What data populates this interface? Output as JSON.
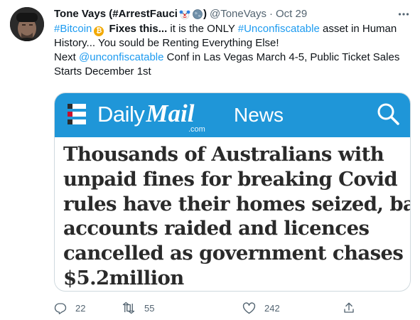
{
  "tweet": {
    "display_name": "Tone Vays (#ArrestFauci",
    "display_name_close": ")",
    "handle": "@ToneVays",
    "separator": "·",
    "date": "Oct 29",
    "more_label": "···",
    "text": {
      "hashtag_bitcoin": "#Bitcoin",
      "bitcoin_symbol": "₿",
      "fixes_this": "Fixes this...",
      "line1_mid": " it is the ONLY ",
      "hashtag_unconfiscatable": "#Unconfiscatable",
      "line1_end": " asset in Human",
      "line2": "History... You sould be Renting Everything Else!",
      "line3_start": "Next ",
      "mention": "@unconfiscatable",
      "line3_end": " Conf in Las Vegas March 4-5, Public Ticket Sales",
      "line4": "Starts December 1st"
    },
    "emoji_icons": [
      "clown-face-icon",
      "globe-icon"
    ]
  },
  "media": {
    "brand_daily": "Daily",
    "brand_mail": "Mail",
    "brand_com": ".com",
    "section": "News",
    "header_color": "#1f96d8",
    "headline_lines": [
      "Thousands of Australians with",
      "unpaid fines for breaking Covid",
      "rules have their homes seized, bank",
      "accounts raided and licences",
      "cancelled as government chases",
      "$5.2million"
    ]
  },
  "actions": {
    "replies": "22",
    "retweets": "55",
    "likes": "242"
  },
  "colors": {
    "accent": "#1d9bf0",
    "secondary_text": "#536471",
    "bitcoin": "#f2a900"
  }
}
